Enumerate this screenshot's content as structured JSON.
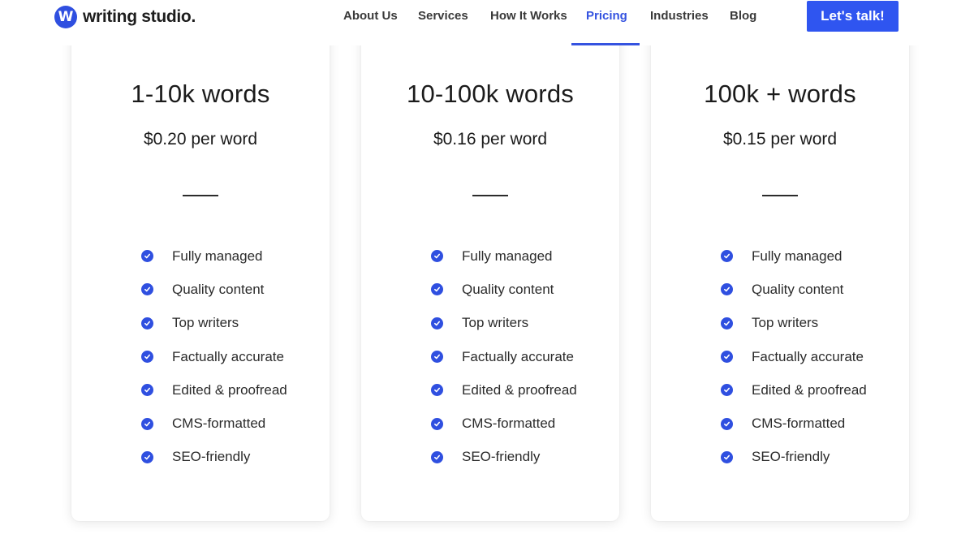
{
  "header": {
    "logo_letter": "W",
    "logo_text": "writing studio.",
    "nav": [
      {
        "label": "About Us"
      },
      {
        "label": "Services"
      },
      {
        "label": "How It Works"
      },
      {
        "label": "Pricing",
        "active": true
      },
      {
        "label": "Industries"
      },
      {
        "label": "Blog"
      }
    ],
    "cta_label": "Let's talk!"
  },
  "plans": [
    {
      "tier": "1-10k words",
      "price": "$0.20 per word",
      "features": [
        "Fully managed",
        "Quality content",
        "Top writers",
        "Factually accurate",
        "Edited & proofread",
        "CMS-formatted",
        "SEO-friendly"
      ]
    },
    {
      "tier": "10-100k words",
      "price": "$0.16 per word",
      "features": [
        "Fully managed",
        "Quality content",
        "Top writers",
        "Factually accurate",
        "Edited & proofread",
        "CMS-formatted",
        "SEO-friendly"
      ]
    },
    {
      "tier": "100k + words",
      "price": "$0.15 per word",
      "features": [
        "Fully managed",
        "Quality content",
        "Top writers",
        "Factually accurate",
        "Edited & proofread",
        "CMS-formatted",
        "SEO-friendly"
      ]
    }
  ],
  "icons": {
    "feature_check": "check-circle-icon",
    "logo": "logo-w-icon"
  },
  "colors": {
    "accent": "#2f4fe0",
    "cta": "#2f55f0",
    "nav_active": "#3553e0",
    "text": "#1b1b1b"
  }
}
